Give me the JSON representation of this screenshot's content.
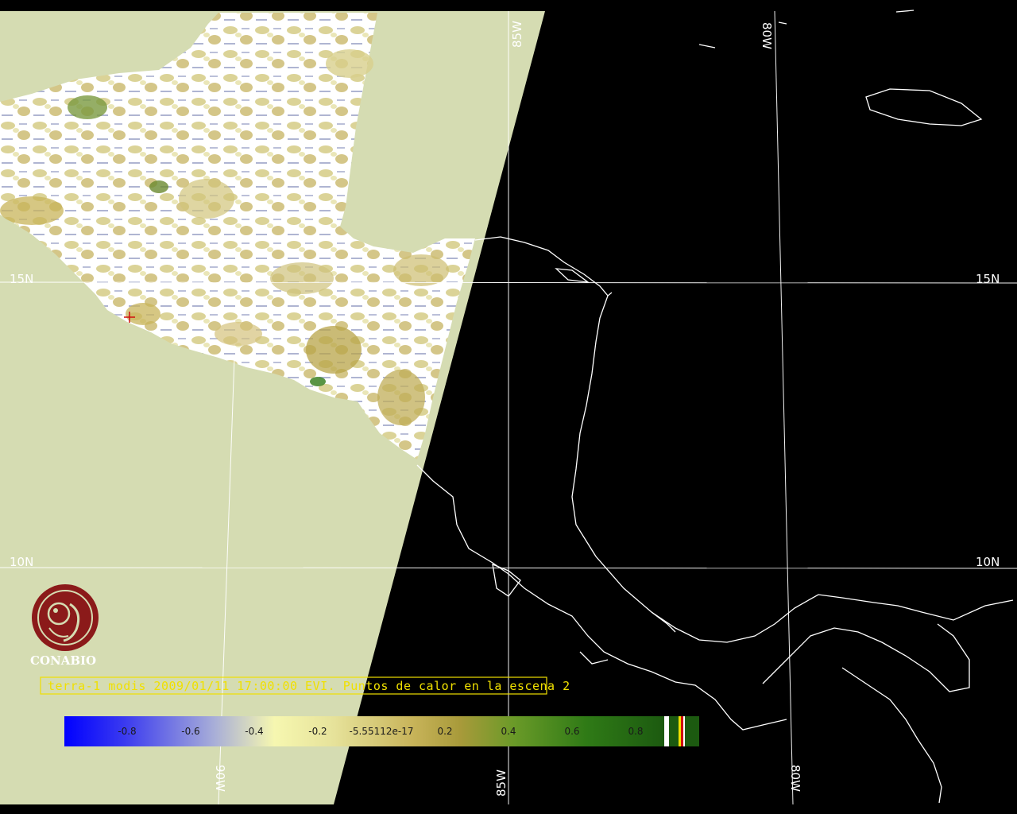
{
  "caption": "terra-1 modis 2009/01/11 17:00:00 EVI. Puntos de calor en la escena 2",
  "logo": {
    "text": "CONABIO",
    "icon": "conabio-macaw-logo-icon"
  },
  "grid_labels": {
    "lon_85w_top": "85W",
    "lon_80w_top": "80W",
    "lon_90w_bottom": "90W",
    "lon_85w_bottom": "85W",
    "lon_80w_bottom": "80W",
    "lat_15n_left": "15N",
    "lat_15n_right": "15N",
    "lat_10n_left": "10N",
    "lat_10n_right": "10N"
  },
  "colorbar": {
    "ticks": [
      "-0.8",
      "-0.6",
      "-0.4",
      "-0.2",
      "-5.55112e-17",
      "0.2",
      "0.4",
      "0.6",
      "0.8"
    ],
    "range": [
      -1,
      1
    ],
    "colors": {
      "low": "#0000ff",
      "mid_low": "#f6f7b0",
      "mid": "#b8a040",
      "high": "#1f6a10"
    }
  },
  "colors": {
    "background": "#000000",
    "land_nodata": "#d5dcb2",
    "cloud": "#ffffff",
    "coast_grid": "#ffffff",
    "caption": "#f0e000",
    "logo": "#8b1a1a",
    "hotspot": "#d01010"
  }
}
